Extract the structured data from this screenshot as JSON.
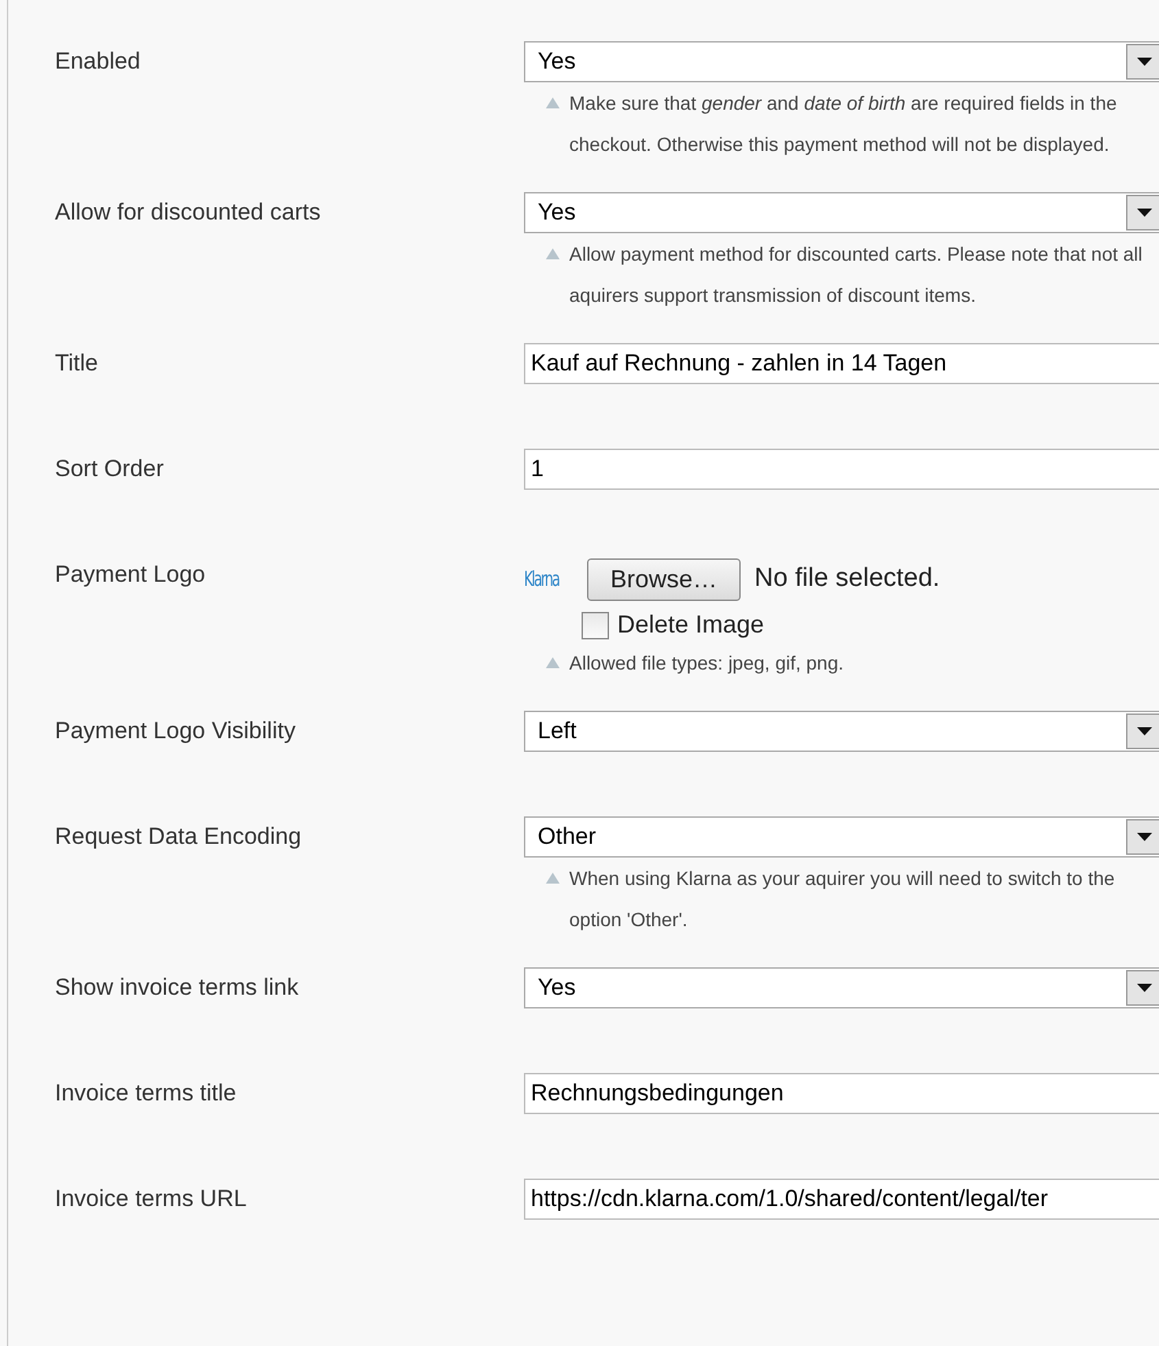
{
  "fields": [
    {
      "label": "Enabled",
      "kind": "select",
      "value": "Yes",
      "hint": "Make sure that *gender* and *date of birth* are required fields in the checkout. Otherwise this payment method will not be displayed."
    },
    {
      "label": "Allow for discounted carts",
      "kind": "select",
      "value": "Yes",
      "hint": "Allow payment method for discounted carts. Please note that not all aquirers support transmission of discount items."
    },
    {
      "label": "Title",
      "kind": "text",
      "value": "Kauf auf Rechnung - zahlen in 14 Tagen"
    },
    {
      "label": "Sort Order",
      "kind": "text",
      "value": "1"
    },
    {
      "label": "Payment Logo",
      "kind": "file",
      "logo": "Klarna",
      "button": "Browse…",
      "status": "No file selected.",
      "checkbox": {
        "label": "Delete Image",
        "checked": false
      },
      "hint": "Allowed file types: jpeg, gif, png."
    },
    {
      "label": "Payment Logo Visibility",
      "kind": "select",
      "value": "Left"
    },
    {
      "label": "Request Data Encoding",
      "kind": "select",
      "value": "Other",
      "hint": "When using Klarna as your aquirer you will need to switch to the option 'Other'."
    },
    {
      "label": "Show invoice terms link",
      "kind": "select",
      "value": "Yes"
    },
    {
      "label": "Invoice terms title",
      "kind": "text",
      "value": "Rechnungsbedingungen"
    },
    {
      "label": "Invoice terms URL",
      "kind": "text",
      "value": "https://cdn.klarna.com/1.0/shared/content/legal/ter"
    }
  ]
}
